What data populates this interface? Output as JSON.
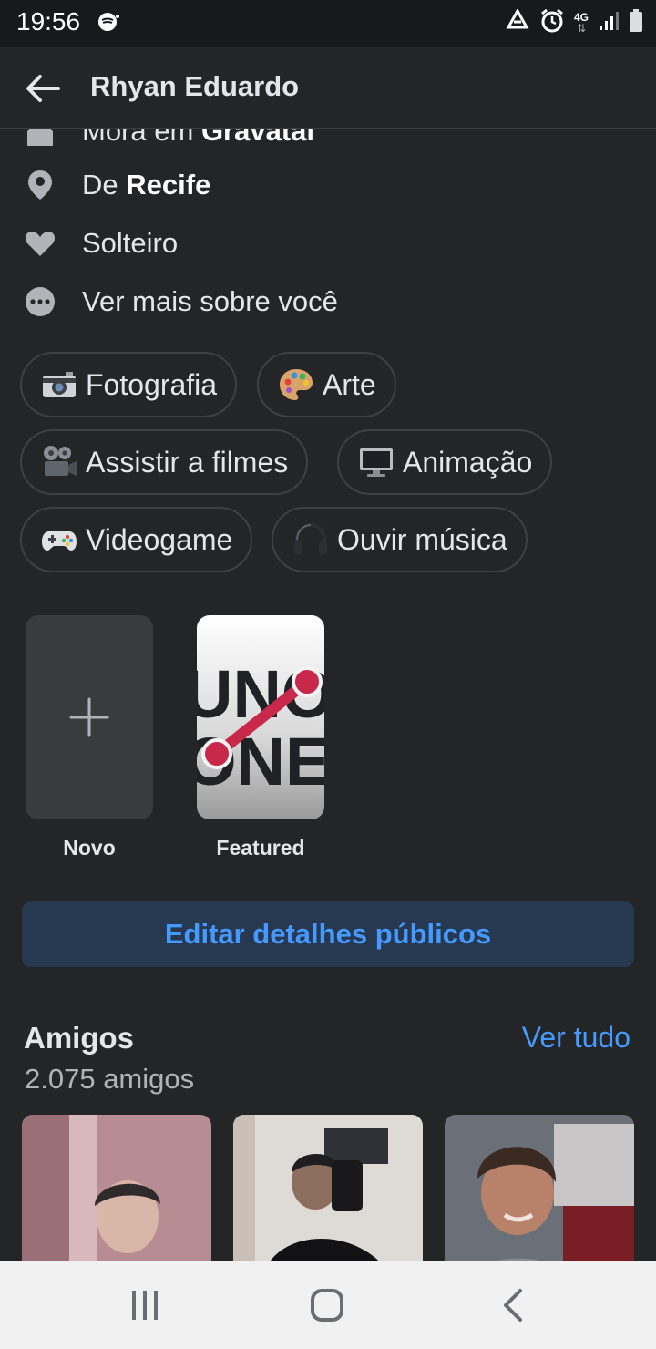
{
  "status_bar": {
    "time": "19:56",
    "network": "4G",
    "icons": [
      "spotify-icon",
      "recycle-icon",
      "alarm-icon",
      "signal-icon",
      "battery-icon"
    ]
  },
  "app_bar": {
    "title": "Rhyan Eduardo",
    "back_icon": "arrow-left-icon"
  },
  "intro": {
    "lives_prefix": "Mora em",
    "lives_city": "Gravataí",
    "from_prefix": "De",
    "from_city": "Recife",
    "relationship": "Solteiro",
    "see_more": "Ver mais sobre você"
  },
  "hobbies": [
    {
      "label": "Fotografia",
      "icon": "camera-icon"
    },
    {
      "label": "Arte",
      "icon": "palette-icon"
    },
    {
      "label": "Assistir a filmes",
      "icon": "film-projector-icon"
    },
    {
      "label": "Animação",
      "icon": "monitor-icon"
    },
    {
      "label": "Videogame",
      "icon": "gamepad-icon"
    },
    {
      "label": "Ouvir música",
      "icon": "headphones-icon"
    }
  ],
  "featured": {
    "new_label": "Novo",
    "featured_label": "Featured",
    "logo_top": "UNO",
    "logo_bottom": "ONE"
  },
  "edit_button": "Editar detalhes públicos",
  "friends": {
    "title": "Amigos",
    "see_all": "Ver tudo",
    "count": "2.075 amigos"
  },
  "colors": {
    "background": "#242526",
    "accent": "#4599ff",
    "edit_button_bg": "#263951",
    "nav_bar": "#f1f1f1"
  }
}
